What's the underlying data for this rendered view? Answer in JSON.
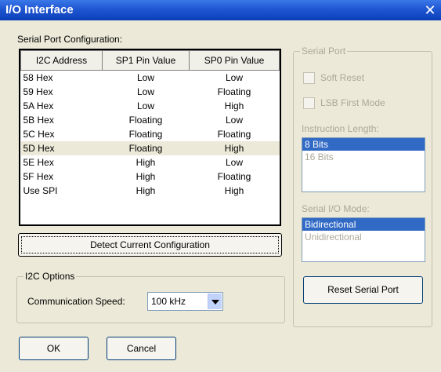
{
  "window": {
    "title": "I/O Interface"
  },
  "icons": {
    "close": "close-icon",
    "dropdown": "chevron-down-icon"
  },
  "colors": {
    "titlebar": "#0A3FB8",
    "selection": "#316AC5",
    "face": "#ECE9D8"
  },
  "serial_config": {
    "label": "Serial Port Configuration:",
    "columns": [
      "I2C Address",
      "SP1 Pin Value",
      "SP0 Pin Value"
    ],
    "rows": [
      [
        "58 Hex",
        "Low",
        "Low"
      ],
      [
        "59 Hex",
        "Low",
        "Floating"
      ],
      [
        "5A Hex",
        "Low",
        "High"
      ],
      [
        "5B Hex",
        "Floating",
        "Low"
      ],
      [
        "5C Hex",
        "Floating",
        "Floating"
      ],
      [
        "5D Hex",
        "Floating",
        "High"
      ],
      [
        "5E Hex",
        "High",
        "Low"
      ],
      [
        "5F Hex",
        "High",
        "Floating"
      ],
      [
        "Use SPI",
        "High",
        "High"
      ]
    ],
    "selected_row": "5D Hex",
    "detect_button": "Detect Current Configuration"
  },
  "i2c_options": {
    "title": "I2C Options",
    "speed_label": "Communication Speed:",
    "speed_value": "100 kHz"
  },
  "serial_port": {
    "title": "Serial Port",
    "soft_reset": "Soft Reset",
    "lsb_first": "LSB First Mode",
    "instruction_length_label": "Instruction Length:",
    "instruction_length_options": [
      "8 Bits",
      "16 Bits"
    ],
    "instruction_length_selected": "8 Bits",
    "io_mode_label": "Serial I/O Mode:",
    "io_mode_options": [
      "Bidirectional",
      "Unidirectional"
    ],
    "io_mode_selected": "Bidirectional",
    "reset_button": "Reset Serial Port"
  },
  "footer": {
    "ok": "OK",
    "cancel": "Cancel"
  }
}
